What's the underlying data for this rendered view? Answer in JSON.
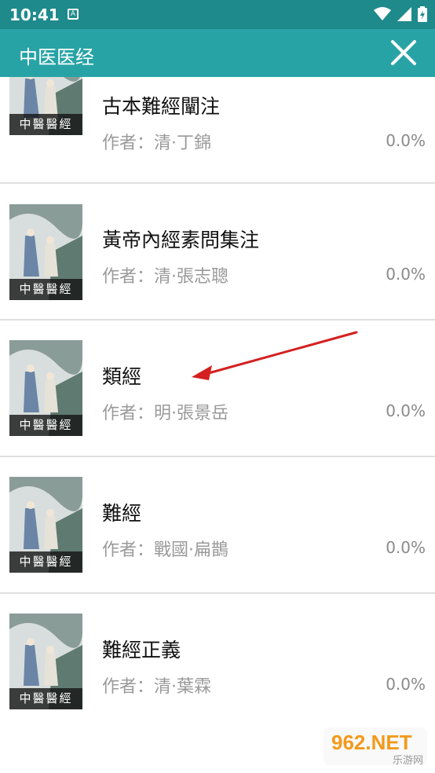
{
  "status_bar": {
    "time": "10:41",
    "notification_letter": "A"
  },
  "app_bar": {
    "title": "中医医经"
  },
  "cover_caption": "中醫醫經",
  "books": [
    {
      "title": "古本難經闡注",
      "author": "作者：清·丁錦",
      "progress": "0.0%"
    },
    {
      "title": "黃帝內經素問集注",
      "author": "作者：清·張志聰",
      "progress": "0.0%"
    },
    {
      "title": "類經",
      "author": "作者：明·張景岳",
      "progress": "0.0%"
    },
    {
      "title": "難經",
      "author": "作者：戰國·扁鵲",
      "progress": "0.0%"
    },
    {
      "title": "難經正義",
      "author": "作者：清·葉霖",
      "progress": "0.0%"
    }
  ],
  "watermark": {
    "text": "962.NET",
    "sub": "乐游网"
  },
  "colors": {
    "status_bar": "#1f8a8c",
    "app_bar": "#28a3a5",
    "annotation_arrow": "#d42020"
  }
}
